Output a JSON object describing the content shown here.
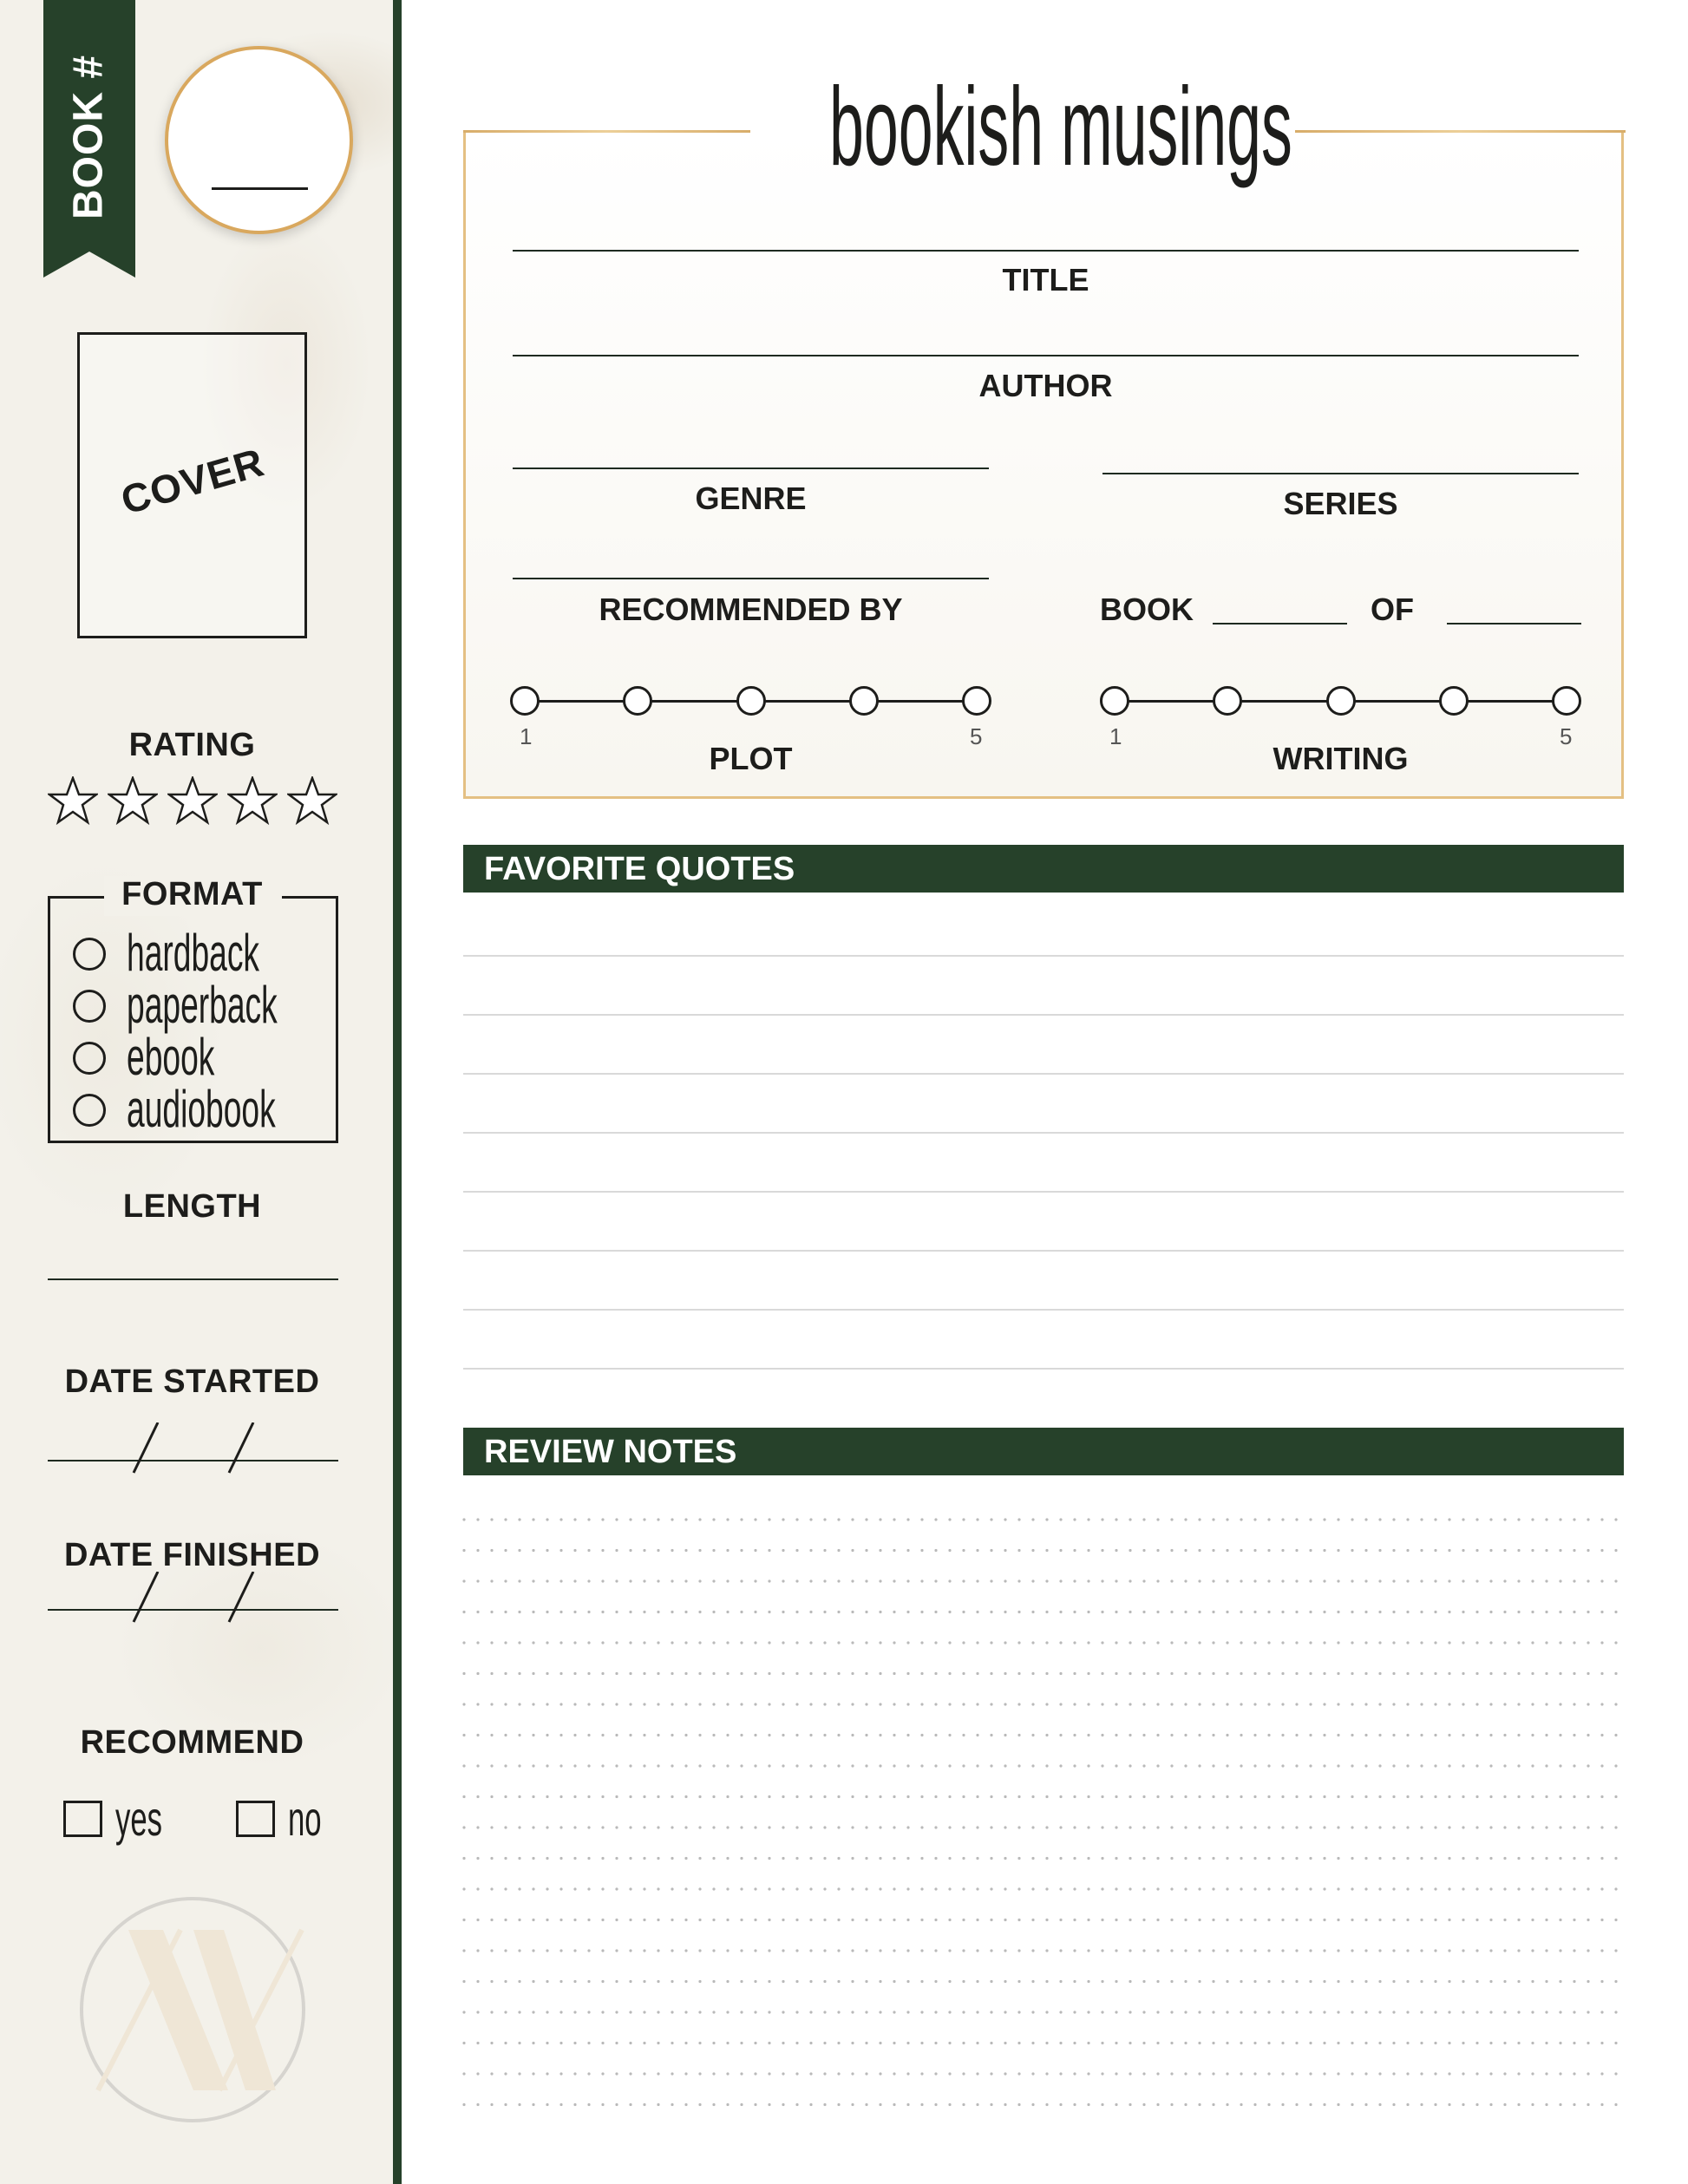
{
  "colors": {
    "accent_green": "#26412a",
    "gold": "#e4c083",
    "paper": "#f3f1ea"
  },
  "sidebar": {
    "ribbon_label": "BOOK #",
    "book_number": "",
    "cover_label": "COVER",
    "rating": {
      "label": "RATING",
      "max_stars": 5,
      "value": 0
    },
    "format": {
      "label": "FORMAT",
      "options": [
        {
          "label": "hardback",
          "selected": false
        },
        {
          "label": "paperback",
          "selected": false
        },
        {
          "label": "ebook",
          "selected": false
        },
        {
          "label": "audiobook",
          "selected": false
        }
      ]
    },
    "length": {
      "label": "LENGTH",
      "value": ""
    },
    "date_started": {
      "label": "DATE STARTED",
      "separator": "/",
      "value": ""
    },
    "date_finished": {
      "label": "DATE FINISHED",
      "separator": "/",
      "value": ""
    },
    "recommend": {
      "label": "RECOMMEND",
      "options": [
        {
          "label": "yes",
          "checked": false
        },
        {
          "label": "no",
          "checked": false
        }
      ]
    },
    "logo_icon": "monogram-logo"
  },
  "header": {
    "title": "bookish musings"
  },
  "details": {
    "title_label": "TITLE",
    "author_label": "AUTHOR",
    "genre_label": "GENRE",
    "series_label": "SERIES",
    "recommended_by_label": "RECOMMENDED BY",
    "book_label": "BOOK",
    "of_label": "OF",
    "plot": {
      "label": "PLOT",
      "min": "1",
      "max": "5",
      "steps": 5,
      "value": null
    },
    "writing": {
      "label": "WRITING",
      "min": "1",
      "max": "5",
      "steps": 5,
      "value": null
    }
  },
  "quotes": {
    "label": "FAVORITE QUOTES",
    "line_count": 8
  },
  "notes": {
    "label": "REVIEW NOTES",
    "dot_rows": 20,
    "dot_cols": 84
  }
}
